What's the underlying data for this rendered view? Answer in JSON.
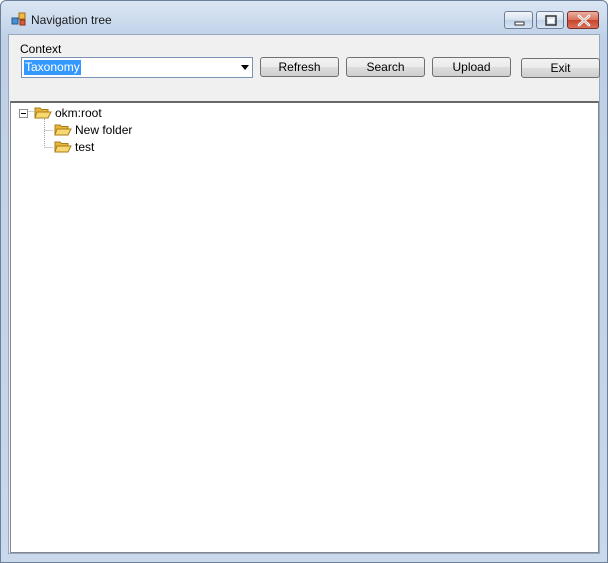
{
  "window": {
    "title": "Navigation tree"
  },
  "toolbar": {
    "context_label": "Context",
    "context_value": "Taxonomy",
    "refresh_label": "Refresh",
    "search_label": "Search",
    "upload_label": "Upload",
    "exit_label": "Exit"
  },
  "tree": {
    "root": {
      "label": "okm:root",
      "expanded": true,
      "icon": "open-folder-icon"
    },
    "children": [
      {
        "label": "New folder",
        "icon": "open-folder-icon"
      },
      {
        "label": "test",
        "icon": "open-folder-icon"
      }
    ]
  },
  "colors": {
    "selection": "#3399ff",
    "folder": "#f3c246"
  }
}
